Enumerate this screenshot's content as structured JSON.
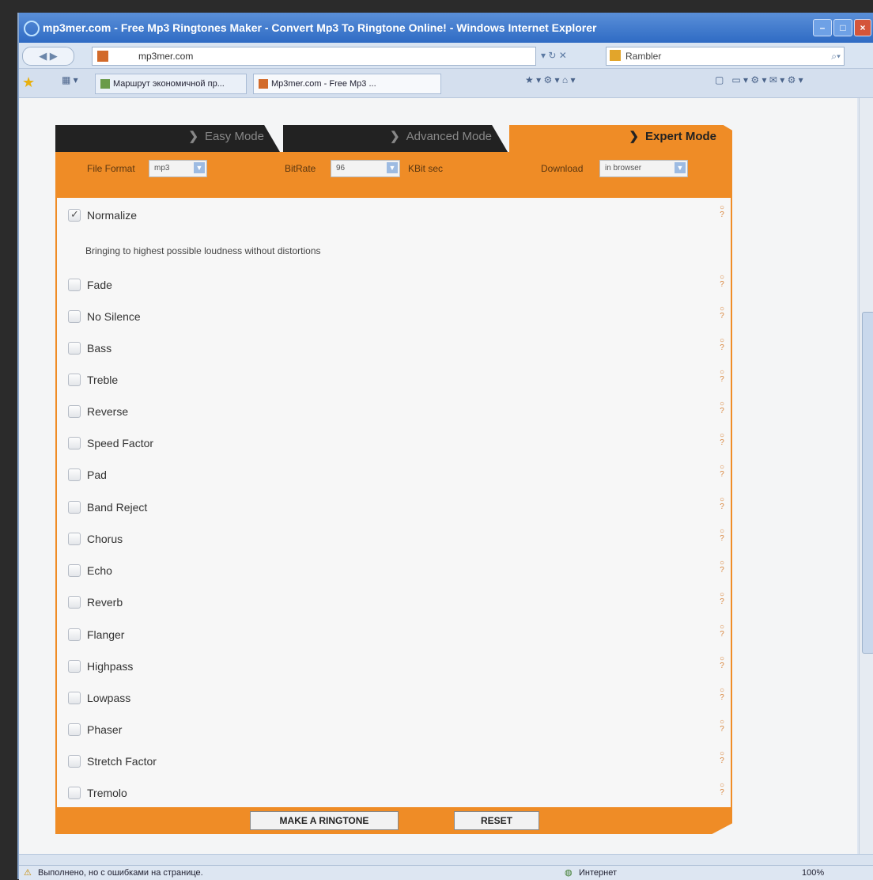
{
  "browser": {
    "title": "mp3mer.com - Free Mp3 Ringtones Maker - Convert Mp3 To Ringtone Online! - Windows Internet Explorer",
    "url": "mp3mer.com",
    "search_engine": "Rambler",
    "tabs": [
      {
        "label": "Маршрут экономичной пр..."
      },
      {
        "label": "Mp3mer.com - Free Mp3 ..."
      }
    ],
    "status_text": "Выполнено, но с ошибками на странице.",
    "zone": "Интернет",
    "zoom": "100%"
  },
  "modes": [
    {
      "label": "Easy Mode",
      "active": false
    },
    {
      "label": "Advanced Mode",
      "active": false
    },
    {
      "label": "Expert Mode",
      "active": true
    }
  ],
  "options": {
    "file_format_label": "File Format",
    "file_format_value": "mp3",
    "bitrate_label": "BitRate",
    "bitrate_value": "96",
    "bitrate_unit": "KBit sec",
    "download_label": "Download",
    "download_value": "in browser"
  },
  "effects": [
    {
      "label": "Normalize",
      "checked": true,
      "description": "Bringing to highest possible loudness without distortions"
    },
    {
      "label": "Fade",
      "checked": false
    },
    {
      "label": "No Silence",
      "checked": false
    },
    {
      "label": "Bass",
      "checked": false
    },
    {
      "label": "Treble",
      "checked": false
    },
    {
      "label": "Reverse",
      "checked": false
    },
    {
      "label": "Speed Factor",
      "checked": false
    },
    {
      "label": "Pad",
      "checked": false
    },
    {
      "label": "Band Reject",
      "checked": false
    },
    {
      "label": "Chorus",
      "checked": false
    },
    {
      "label": "Echo",
      "checked": false
    },
    {
      "label": "Reverb",
      "checked": false
    },
    {
      "label": "Flanger",
      "checked": false
    },
    {
      "label": "Highpass",
      "checked": false
    },
    {
      "label": "Lowpass",
      "checked": false
    },
    {
      "label": "Phaser",
      "checked": false
    },
    {
      "label": "Stretch Factor",
      "checked": false
    },
    {
      "label": "Tremolo",
      "checked": false
    }
  ],
  "actions": {
    "make_label": "MAKE A RINGTONE",
    "reset_label": "RESET"
  },
  "colors": {
    "accent": "#ef8c26",
    "dark_tab": "#222222"
  }
}
